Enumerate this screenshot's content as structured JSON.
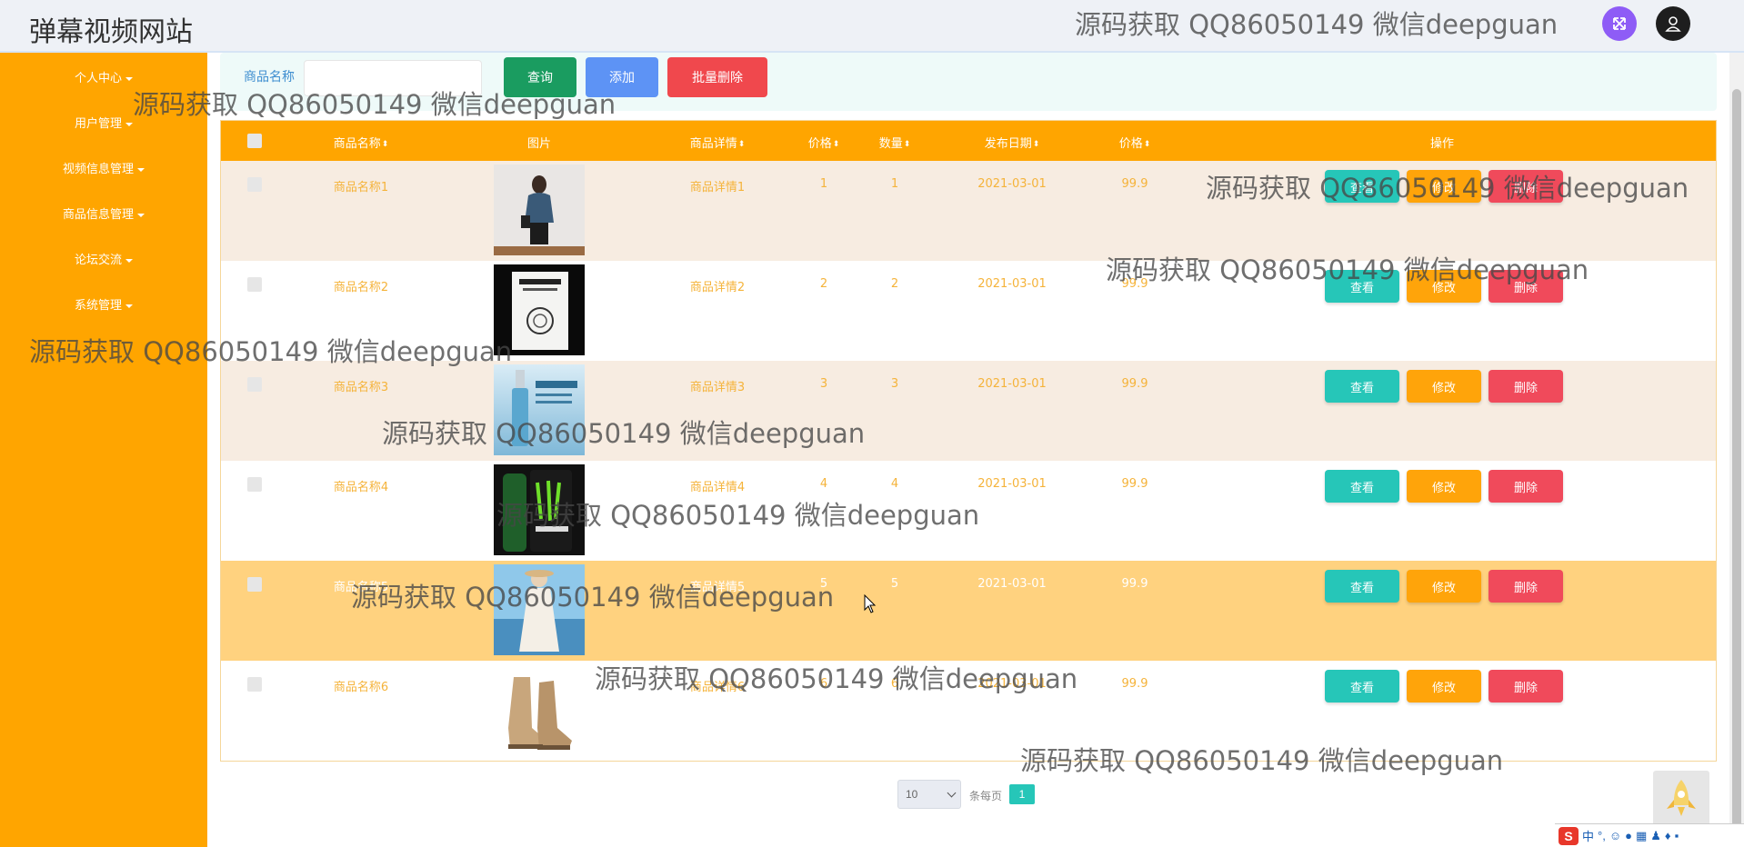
{
  "header": {
    "site_title": "弹幕视频网站"
  },
  "sidebar": {
    "items": [
      {
        "label": "个人中心"
      },
      {
        "label": "用户管理"
      },
      {
        "label": "视频信息管理"
      },
      {
        "label": "商品信息管理"
      },
      {
        "label": "论坛交流"
      },
      {
        "label": "系统管理"
      }
    ]
  },
  "search": {
    "label": "商品名称",
    "value": "",
    "placeholder": "",
    "query_label": "查询",
    "add_label": "添加",
    "batch_delete_label": "批量删除"
  },
  "table": {
    "headers": {
      "name": "商品名称",
      "image": "图片",
      "detail": "商品详情",
      "price": "价格",
      "quantity": "数量",
      "date": "发布日期",
      "price2": "价格",
      "actions": "操作"
    },
    "rows": [
      {
        "name": "商品名称1",
        "image": "woman-in-denim-jacket",
        "detail": "商品详情1",
        "price": "1",
        "quantity": "1",
        "date": "2021-03-01",
        "price2": "99.9"
      },
      {
        "name": "商品名称2",
        "image": "book-cover",
        "detail": "商品详情2",
        "price": "2",
        "quantity": "2",
        "date": "2021-03-01",
        "price2": "99.9"
      },
      {
        "name": "商品名称3",
        "image": "serum-bottle",
        "detail": "商品详情3",
        "price": "3",
        "quantity": "3",
        "date": "2021-03-01",
        "price2": "99.9"
      },
      {
        "name": "商品名称4",
        "image": "monster-energy-can",
        "detail": "商品详情4",
        "price": "4",
        "quantity": "4",
        "date": "2021-03-01",
        "price2": "99.9"
      },
      {
        "name": "商品名称5",
        "image": "woman-in-white-dress",
        "detail": "商品详情5",
        "price": "5",
        "quantity": "5",
        "date": "2021-03-01",
        "price2": "99.9"
      },
      {
        "name": "商品名称6",
        "image": "tan-boots",
        "detail": "商品详情6",
        "price": "6",
        "quantity": "6",
        "date": "2021-03-01",
        "price2": "99.9"
      }
    ],
    "action_labels": {
      "view": "查看",
      "edit": "修改",
      "delete": "删除"
    }
  },
  "pagination": {
    "page_size": "10",
    "per_page_label": "条每页",
    "current_page": "1"
  },
  "watermark_text": "源码获取 QQ86050149 微信deepguan",
  "ime": {
    "logo": "S",
    "mode": "中"
  },
  "colors": {
    "sidebar": "#ffa500",
    "table_header": "#ffa500",
    "view_button": "#26c6b8",
    "edit_button": "#ffa40a",
    "delete_button": "#f04a5b",
    "query_button": "#1a9c60",
    "add_button": "#5d93f5",
    "batch_delete_button": "#f0484d"
  }
}
